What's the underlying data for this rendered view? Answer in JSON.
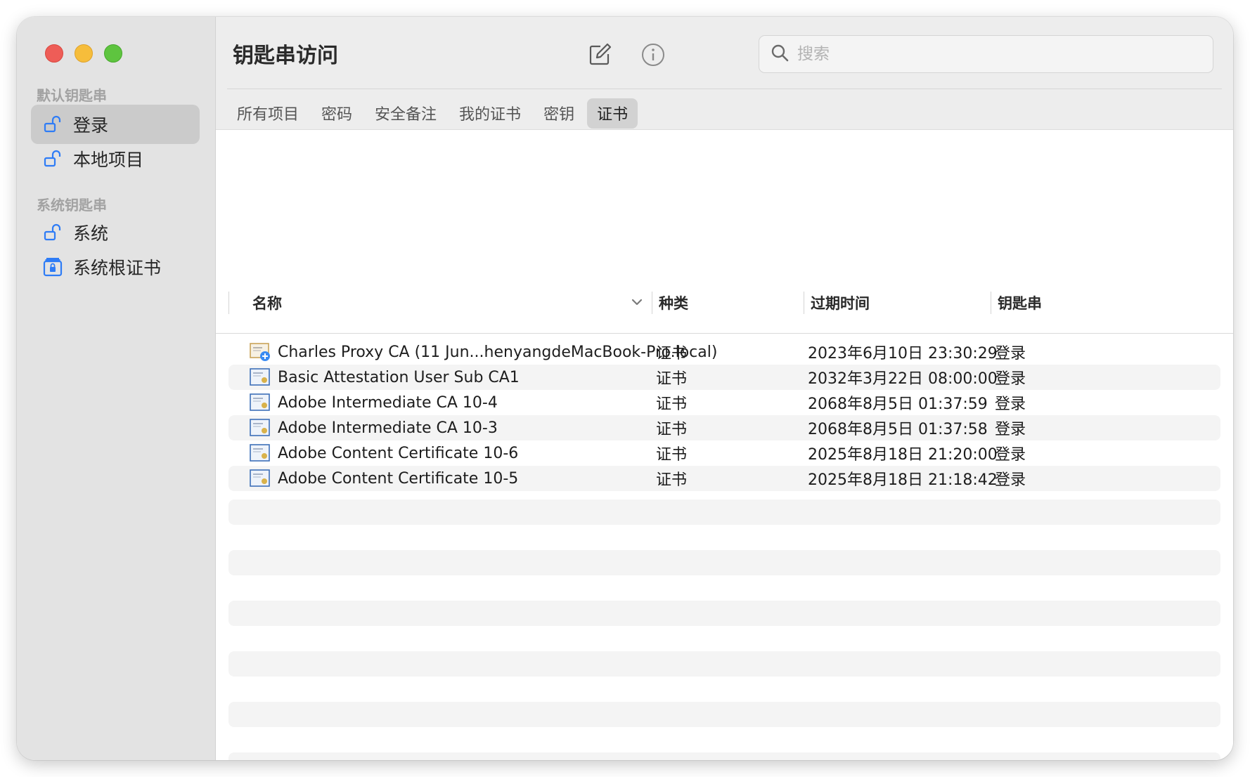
{
  "window": {
    "title": "钥匙串访问"
  },
  "sidebar": {
    "sections": [
      {
        "label": "默认钥匙串",
        "items": [
          {
            "label": "登录",
            "icon": "unlocked-padlock-icon",
            "selected": true
          },
          {
            "label": "本地项目",
            "icon": "unlocked-padlock-icon",
            "selected": false
          }
        ]
      },
      {
        "label": "系统钥匙串",
        "items": [
          {
            "label": "系统",
            "icon": "unlocked-padlock-icon",
            "selected": false
          },
          {
            "label": "系统根证书",
            "icon": "locked-cabinet-icon",
            "selected": false
          }
        ]
      }
    ]
  },
  "toolbar": {
    "compose_icon": "compose-icon",
    "info_icon": "info-icon",
    "search_placeholder": "搜索"
  },
  "tabs": [
    {
      "label": "所有项目",
      "active": false
    },
    {
      "label": "密码",
      "active": false
    },
    {
      "label": "安全备注",
      "active": false
    },
    {
      "label": "我的证书",
      "active": false
    },
    {
      "label": "密钥",
      "active": false
    },
    {
      "label": "证书",
      "active": true
    }
  ],
  "table": {
    "columns": [
      "名称",
      "种类",
      "过期时间",
      "钥匙串"
    ],
    "sort_icon": "chevron-down-icon",
    "rows": [
      {
        "name": "Charles Proxy CA (11 Jun...henyangdeMacBook-Pro.local)",
        "kind": "证书",
        "expires": "2023年6月10日 23:30:29",
        "keychain": "登录",
        "icon": "certificate-plus-icon"
      },
      {
        "name": "Basic Attestation User Sub CA1",
        "kind": "证书",
        "expires": "2032年3月22日 08:00:00",
        "keychain": "登录",
        "icon": "certificate-icon"
      },
      {
        "name": "Adobe Intermediate CA 10-4",
        "kind": "证书",
        "expires": "2068年8月5日 01:37:59",
        "keychain": "登录",
        "icon": "certificate-icon"
      },
      {
        "name": "Adobe Intermediate CA 10-3",
        "kind": "证书",
        "expires": "2068年8月5日 01:37:58",
        "keychain": "登录",
        "icon": "certificate-icon"
      },
      {
        "name": "Adobe Content Certificate 10-6",
        "kind": "证书",
        "expires": "2025年8月18日 21:20:00",
        "keychain": "登录",
        "icon": "certificate-icon"
      },
      {
        "name": "Adobe Content Certificate 10-5",
        "kind": "证书",
        "expires": "2025年8月18日 21:18:42",
        "keychain": "登录",
        "icon": "certificate-icon"
      }
    ]
  },
  "colors": {
    "sidebar_bg": "#e3e3e3",
    "accent_blue": "#2e7cf6",
    "close": "#ee5d57",
    "minimize": "#f6bd3b",
    "zoom": "#5ec43f"
  }
}
